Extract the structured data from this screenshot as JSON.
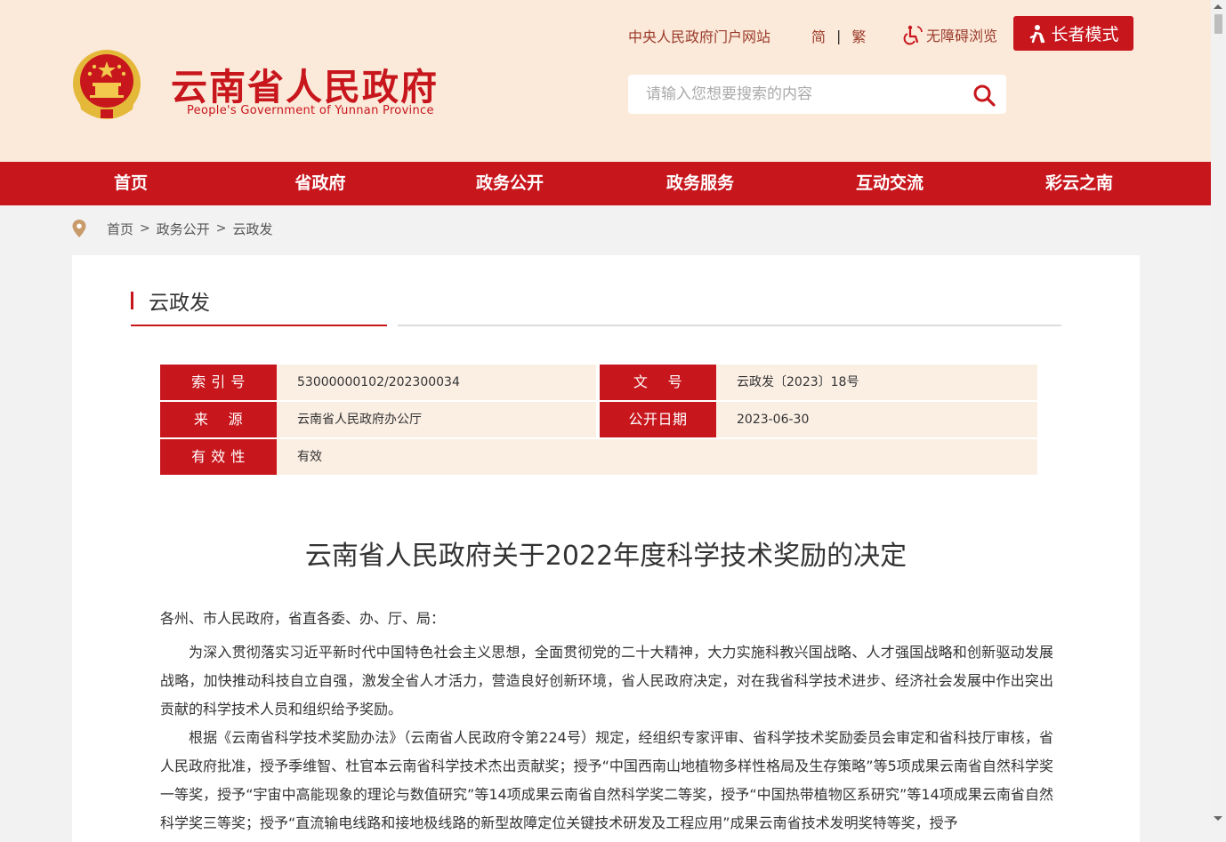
{
  "header": {
    "site_title": "云南省人民政府",
    "site_subtitle": "People's Government of Yunnan Province",
    "gov_link": "中央人民政府门户网站",
    "lang_simplified": "简",
    "lang_separator": "|",
    "lang_traditional": "繁",
    "accessibility": "无障碍浏览",
    "elder_mode": "长者模式",
    "search_placeholder": "请输入您想要搜索的内容"
  },
  "nav": [
    "首页",
    "省政府",
    "政务公开",
    "政务服务",
    "互动交流",
    "彩云之南"
  ],
  "breadcrumb": {
    "items": [
      "首页",
      "政务公开",
      "云政发"
    ],
    "separator": ">"
  },
  "section_title": "云政发",
  "meta": {
    "index_label": "索 引 号",
    "index_value": "53000000102/202300034",
    "docno_label": "文    号",
    "docno_value": "云政发〔2023〕18号",
    "source_label": "来    源",
    "source_value": "云南省人民政府办公厅",
    "date_label": "公开日期",
    "date_value": "2023-06-30",
    "valid_label": "有 效 性",
    "valid_value": "有效"
  },
  "document": {
    "title": "云南省人民政府关于2022年度科学技术奖励的决定",
    "salutation": "各州、市人民政府，省直各委、办、厅、局：",
    "para1": "为深入贯彻落实习近平新时代中国特色社会主义思想，全面贯彻党的二十大精神，大力实施科教兴国战略、人才强国战略和创新驱动发展战略，加快推动科技自立自强，激发全省人才活力，营造良好创新环境，省人民政府决定，对在我省科学技术进步、经济社会发展中作出突出贡献的科学技术人员和组织给予奖励。",
    "para2": "根据《云南省科学技术奖励办法》（云南省人民政府令第224号）规定，经组织专家评审、省科学技术奖励委员会审定和省科技厅审核，省人民政府批准，授予季维智、杜官本云南省科学技术杰出贡献奖；授予“中国西南山地植物多样性格局及生存策略”等5项成果云南省自然科学奖一等奖，授予“宇宙中高能现象的理论与数值研究”等14项成果云南省自然科学奖二等奖，授予“中国热带植物区系研究”等14项成果云南省自然科学奖三等奖；授予“直流输电线路和接地极线路的新型故障定位关键技术研发及工程应用”成果云南省技术发明奖特等奖，授予"
  },
  "colors": {
    "brand_red": "#c8161d",
    "header_bg": "#fbe9d9",
    "meta_value_bg": "#fbefe4"
  }
}
